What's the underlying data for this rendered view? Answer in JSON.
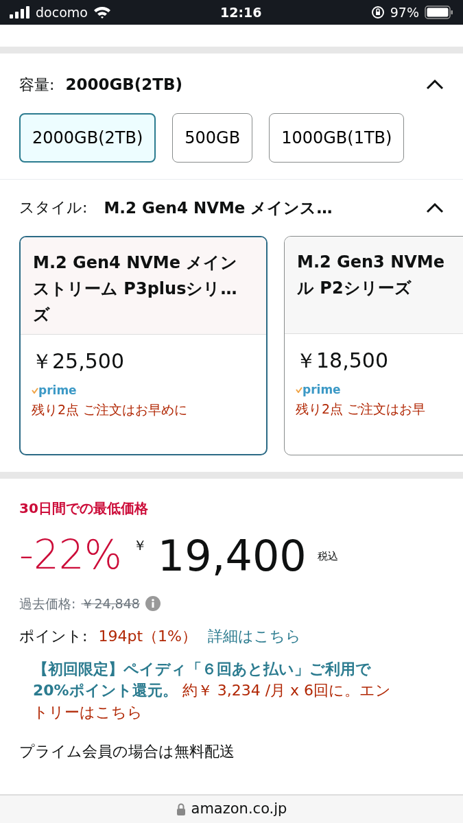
{
  "status_bar": {
    "carrier": "docomo",
    "time": "12:16",
    "battery": "97%"
  },
  "capacity": {
    "label": "容量:",
    "value": "2000GB(2TB)",
    "expanded": true,
    "options": [
      {
        "label": "2000GB(2TB)",
        "selected": true
      },
      {
        "label": "500GB",
        "selected": false
      },
      {
        "label": "1000GB(1TB)",
        "selected": false
      }
    ]
  },
  "style": {
    "label": "スタイル:",
    "value": "M.2 Gen4 NVMe メインス…",
    "expanded": true,
    "cards": [
      {
        "title_lines": [
          "M.2 Gen4 NVMe メイン",
          "ストリーム P3plusシリ…",
          "ズ"
        ],
        "price": "￥25,500",
        "prime": "prime",
        "stock": "残り2点 ご注文はお早めに",
        "selected": true
      },
      {
        "title_lines": [
          "M.2 Gen3 NVMe",
          "ル P2シリーズ"
        ],
        "price": "￥18,500",
        "prime": "prime",
        "stock": "残り2点 ご注文はお早",
        "selected": false
      }
    ]
  },
  "deal": {
    "badge": "30日間での最低価格",
    "discount": "-22%",
    "currency": "￥",
    "price": "19,400",
    "tax": "税込"
  },
  "past_price": {
    "label": "過去価格:",
    "value": "￥24,848"
  },
  "points": {
    "label": "ポイント:",
    "value": "194pt（1%）",
    "link": "詳細はこちら"
  },
  "promo": {
    "headline": "【初回限定】ペイディ「６回あと払い」ご利用で20%ポイント還元。",
    "offer": "約￥ 3,234 /月 x 6回に。エントリーはこちら"
  },
  "shipping": "プライム会員の場合は無料配送",
  "address_bar": {
    "url": "amazon.co.jp"
  }
}
